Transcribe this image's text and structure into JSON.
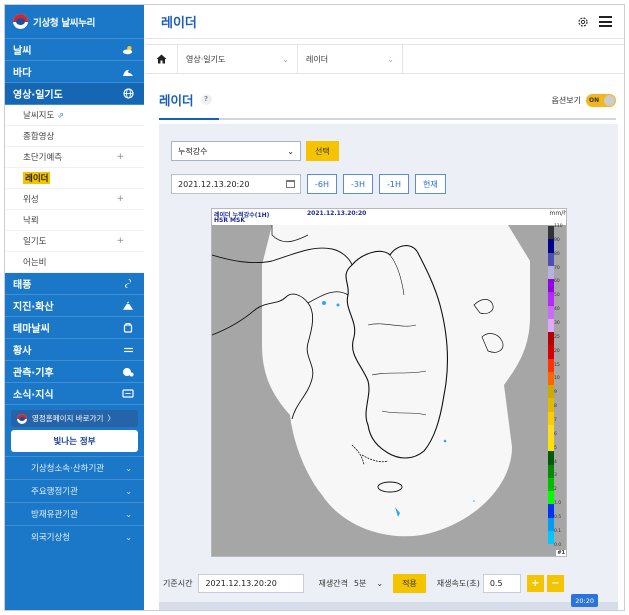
{
  "sidebar": {
    "logo_text": "기상청 날씨누리",
    "menu": [
      {
        "label": "날씨",
        "icon": "sun-cloud-icon"
      },
      {
        "label": "바다",
        "icon": "wave-icon"
      },
      {
        "label": "영상·일기도",
        "icon": "globe-icon"
      }
    ],
    "submenu": [
      {
        "label": "날씨지도",
        "ext": "⇗",
        "plus": ""
      },
      {
        "label": "종합영상",
        "ext": "",
        "plus": ""
      },
      {
        "label": "초단기예측",
        "ext": "",
        "plus": "+"
      },
      {
        "label": "레이더",
        "ext": "",
        "plus": ""
      },
      {
        "label": "위성",
        "ext": "",
        "plus": "+"
      },
      {
        "label": "낙뢰",
        "ext": "",
        "plus": ""
      },
      {
        "label": "일기도",
        "ext": "",
        "plus": "+"
      },
      {
        "label": "어는비",
        "ext": "",
        "plus": ""
      }
    ],
    "menu2": [
      {
        "label": "태풍",
        "icon": "typhoon-icon"
      },
      {
        "label": "지진·화산",
        "icon": "volcano-icon"
      },
      {
        "label": "테마날씨",
        "icon": "theme-icon"
      },
      {
        "label": "황사",
        "icon": "dust-icon"
      },
      {
        "label": "관측·기후",
        "icon": "observation-icon"
      },
      {
        "label": "소식·지식",
        "icon": "news-icon"
      }
    ],
    "promo_text": "영정홈페이지 바로가기",
    "promo_arrow": "〉",
    "banner_main": "빛나는 정부",
    "links": [
      {
        "label": "기상청소속·산하기관"
      },
      {
        "label": "주요행정기관"
      },
      {
        "label": "방재유관기관"
      },
      {
        "label": "외국기상청"
      }
    ]
  },
  "header": {
    "title": "레이더"
  },
  "breadcrumb": {
    "level1": "영상·일기도",
    "level2": "레이더"
  },
  "section": {
    "title": "레이더",
    "help": "?",
    "option_label": "옵션보기",
    "toggle_label": "ON"
  },
  "controls": {
    "product_select": "누적강수",
    "select_button": "선택",
    "datetime": "2021.12.13.20:20",
    "steps": [
      "-6H",
      "-3H",
      "-1H",
      "현재"
    ]
  },
  "map": {
    "header_title": "레이더 누적강수(1H)",
    "header_time": "2021.12.13.20:20",
    "header_sub": "HSR MSK",
    "unit": "mm/h",
    "legend_values": [
      "110",
      "90",
      "80",
      "70",
      "60",
      "50",
      "40",
      "30",
      "25",
      "20",
      "15",
      "10",
      "9",
      "8",
      "7",
      "6",
      "5",
      "4",
      "3",
      "2",
      "1.0",
      "0.5",
      "0.1",
      "0.0"
    ],
    "legend_colors": [
      "#333333",
      "#000390",
      "#4c4eb1",
      "#b3b4de",
      "#9300e4",
      "#b329ff",
      "#c96bff",
      "#e0a9ff",
      "#b40000",
      "#d20000",
      "#ff3200",
      "#ff6600",
      "#ccaa00",
      "#e0b900",
      "#f9cd00",
      "#ffdc1f",
      "#ffe100",
      "#005a00",
      "#008c00",
      "#00be00",
      "#00ff00",
      "#0033f5",
      "#009bf5",
      "#00c8ff"
    ],
    "legend_tag": "#1"
  },
  "playback": {
    "base_time_label": "기준시간",
    "base_time": "2021.12.13.20:20",
    "interval_label": "재생간격",
    "interval_value": "5분",
    "apply_button": "적용",
    "speed_label": "재생속도(초)",
    "speed_value": "0.5",
    "plus": "+",
    "minus": "−",
    "current_badge": "20:20"
  }
}
